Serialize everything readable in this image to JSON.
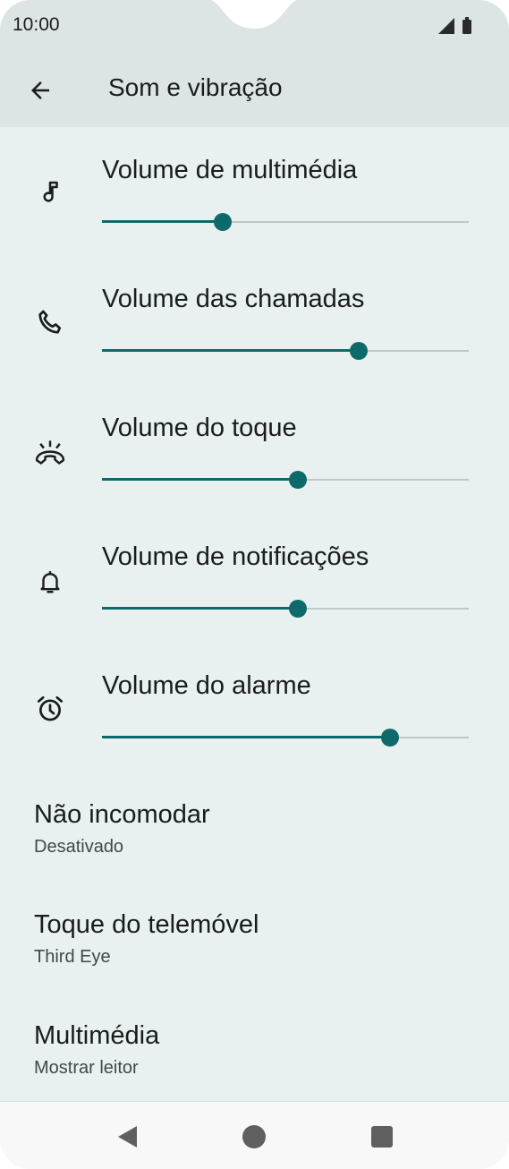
{
  "status_bar": {
    "time": "10:00"
  },
  "app_bar": {
    "title": "Som e vibração"
  },
  "volumes": [
    {
      "label": "Volume de multimédia",
      "icon": "music-note-icon",
      "level": 0.33
    },
    {
      "label": "Volume das chamadas",
      "icon": "phone-icon",
      "level": 0.7
    },
    {
      "label": "Volume do toque",
      "icon": "ringing-phone-icon",
      "level": 0.535
    },
    {
      "label": "Volume de notificações",
      "icon": "bell-icon",
      "level": 0.535
    },
    {
      "label": "Volume do alarme",
      "icon": "alarm-clock-icon",
      "level": 0.785
    }
  ],
  "preferences": [
    {
      "title": "Não incomodar",
      "summary": "Desativado"
    },
    {
      "title": "Toque do telemóvel",
      "summary": "Third Eye"
    },
    {
      "title": "Multimédia",
      "summary": "Mostrar leitor"
    }
  ],
  "nav_bar": {
    "buttons": [
      "back-icon",
      "home-icon",
      "recents-icon"
    ]
  },
  "colors": {
    "accent": "#0e6a6a",
    "background": "#e8f1f0",
    "app_bar": "#dce5e4"
  }
}
